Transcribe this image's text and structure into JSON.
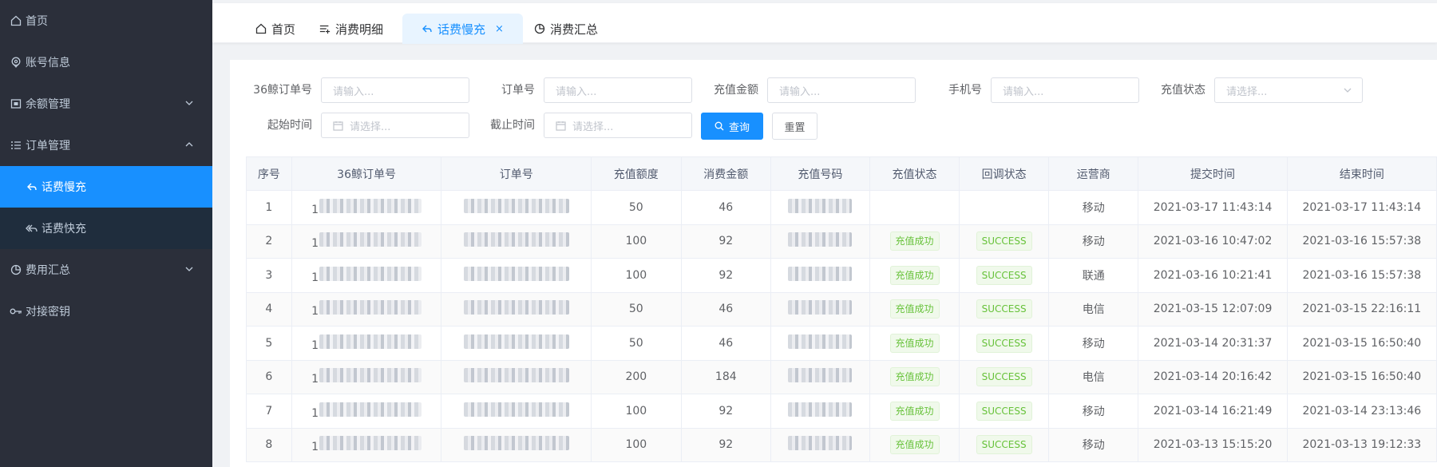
{
  "sidebar": {
    "items": [
      {
        "label": "首页"
      },
      {
        "label": "账号信息"
      },
      {
        "label": "余额管理"
      },
      {
        "label": "订单管理"
      },
      {
        "label": "话费慢充"
      },
      {
        "label": "话费快充"
      },
      {
        "label": "费用汇总"
      },
      {
        "label": "对接密钥"
      }
    ]
  },
  "tabs": [
    {
      "label": "首页"
    },
    {
      "label": "消费明细"
    },
    {
      "label": "话费慢充",
      "close": "×"
    },
    {
      "label": "消费汇总"
    }
  ],
  "filters": {
    "order36_label": "36鲸订单号",
    "order36_placeholder": "请输入...",
    "order_label": "订单号",
    "order_placeholder": "请输入...",
    "amount_label": "充值金额",
    "amount_placeholder": "请输入...",
    "phone_label": "手机号",
    "phone_placeholder": "请输入...",
    "status_label": "充值状态",
    "status_placeholder": "请选择...",
    "start_label": "起始时间",
    "start_placeholder": "请选择...",
    "end_label": "截止时间",
    "end_placeholder": "请选择...",
    "query_button": "查询",
    "reset_button": "重置"
  },
  "table": {
    "headers": [
      "序号",
      "36鲸订单号",
      "订单号",
      "充值额度",
      "消费金额",
      "充值号码",
      "充值状态",
      "回调状态",
      "运营商",
      "提交时间",
      "结束时间"
    ],
    "rows": [
      {
        "index": "1",
        "order36_prefix": "1",
        "amount": "50",
        "cost": "46",
        "status": "",
        "callback": "",
        "carrier": "移动",
        "submit": "2021-03-17 11:43:14",
        "end": "2021-03-17 11:43:14"
      },
      {
        "index": "2",
        "order36_prefix": "1",
        "amount": "100",
        "cost": "92",
        "status": "充值成功",
        "callback": "SUCCESS",
        "carrier": "移动",
        "submit": "2021-03-16 10:47:02",
        "end": "2021-03-16 15:57:38"
      },
      {
        "index": "3",
        "order36_prefix": "1",
        "amount": "100",
        "cost": "92",
        "status": "充值成功",
        "callback": "SUCCESS",
        "carrier": "联通",
        "submit": "2021-03-16 10:21:41",
        "end": "2021-03-16 15:57:38"
      },
      {
        "index": "4",
        "order36_prefix": "1",
        "amount": "50",
        "cost": "46",
        "status": "充值成功",
        "callback": "SUCCESS",
        "carrier": "电信",
        "submit": "2021-03-15 12:07:09",
        "end": "2021-03-15 22:16:11"
      },
      {
        "index": "5",
        "order36_prefix": "1",
        "amount": "50",
        "cost": "46",
        "status": "充值成功",
        "callback": "SUCCESS",
        "carrier": "移动",
        "submit": "2021-03-14 20:31:37",
        "end": "2021-03-15 16:50:40"
      },
      {
        "index": "6",
        "order36_prefix": "1",
        "amount": "200",
        "cost": "184",
        "status": "充值成功",
        "callback": "SUCCESS",
        "carrier": "电信",
        "submit": "2021-03-14 20:16:42",
        "end": "2021-03-15 16:50:40"
      },
      {
        "index": "7",
        "order36_prefix": "1",
        "amount": "100",
        "cost": "92",
        "status": "充值成功",
        "callback": "SUCCESS",
        "carrier": "移动",
        "submit": "2021-03-14 16:21:49",
        "end": "2021-03-14 23:13:46"
      },
      {
        "index": "8",
        "order36_prefix": "1",
        "amount": "100",
        "cost": "92",
        "status": "充值成功",
        "callback": "SUCCESS",
        "carrier": "移动",
        "submit": "2021-03-13 15:15:20",
        "end": "2021-03-13 19:12:33"
      }
    ]
  },
  "colors": {
    "sidebar_bg": "#2b2f3a",
    "accent": "#1890ff",
    "success": "#67c23a"
  }
}
